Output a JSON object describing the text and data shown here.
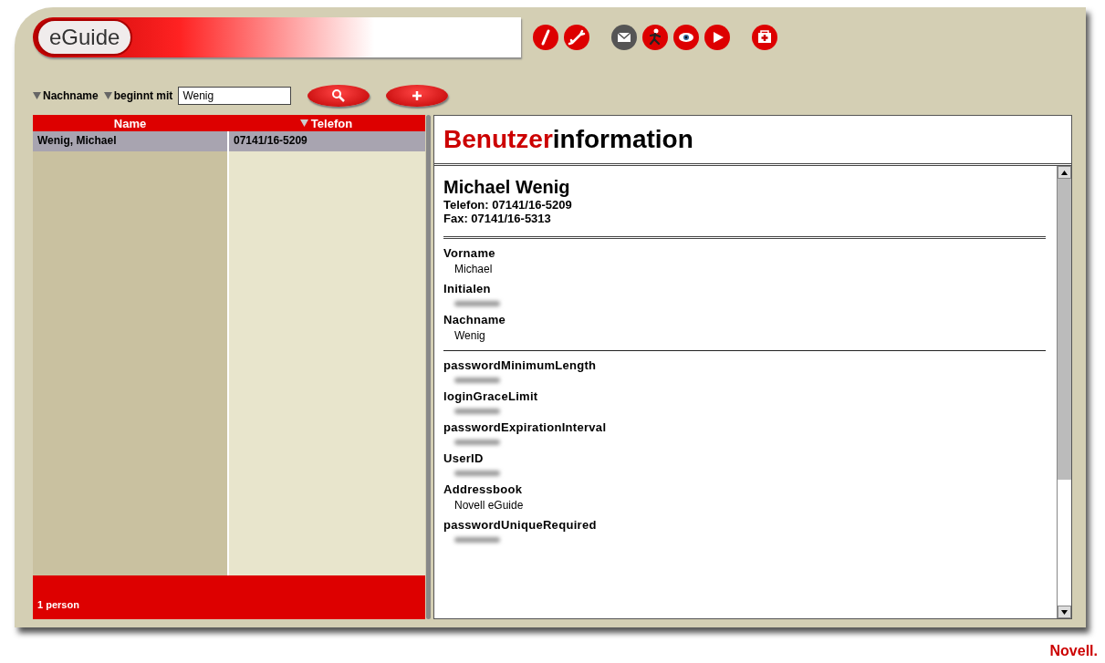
{
  "app": {
    "logo": "eGuide"
  },
  "search": {
    "attribute": "Nachname",
    "operator": "beginnt mit",
    "value": "Wenig"
  },
  "results": {
    "columns": [
      {
        "label": "Name",
        "sorted": false
      },
      {
        "label": "Telefon",
        "sorted": true
      }
    ],
    "rows": [
      {
        "cells": [
          "Wenig, Michael",
          "07141/16-5209"
        ],
        "selected": true
      }
    ],
    "status": "1 person"
  },
  "detail": {
    "title_highlight": "Benutzer",
    "title_rest": "information",
    "person": {
      "name": "Michael Wenig",
      "phone": "Telefon: 07141/16-5209",
      "fax": "Fax: 07141/16-5313"
    },
    "groups": [
      [
        {
          "label": "Vorname",
          "value": "Michael"
        },
        {
          "label": "Initialen",
          "redacted": true
        },
        {
          "label": "Nachname",
          "value": "Wenig"
        }
      ],
      [
        {
          "label": "passwordMinimumLength",
          "redacted": true
        },
        {
          "label": "loginGraceLimit",
          "redacted": true
        },
        {
          "label": "passwordExpirationInterval",
          "redacted": true
        },
        {
          "label": "UserID",
          "redacted": true
        },
        {
          "label": "Addressbook",
          "value": "Novell eGuide"
        },
        {
          "label": "passwordUniqueRequired",
          "redacted": true
        }
      ]
    ]
  },
  "footer_brand": "Novell."
}
